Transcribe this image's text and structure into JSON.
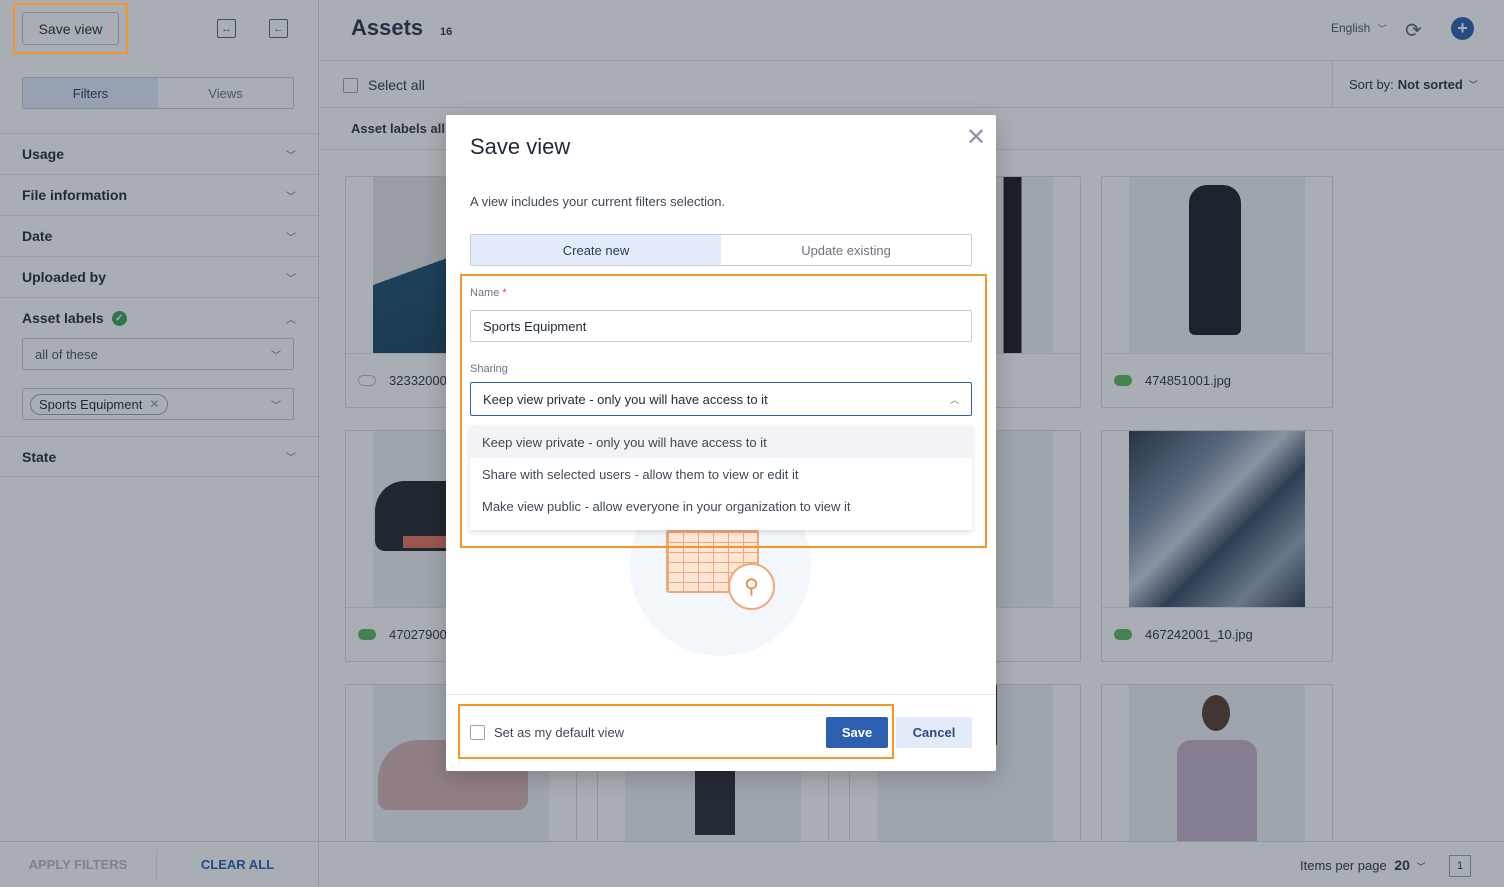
{
  "sidebar": {
    "save_view": "Save view",
    "tabs": [
      "Filters",
      "Views"
    ],
    "facets": {
      "usage": "Usage",
      "file_information": "File information",
      "date": "Date",
      "uploaded_by": "Uploaded by",
      "asset_labels": "Asset labels",
      "state": "State"
    },
    "match_select": "all of these",
    "chip": "Sports Equipment",
    "apply_filters": "APPLY FILTERS",
    "clear_all": "CLEAR ALL"
  },
  "header": {
    "title": "Assets",
    "count": "16",
    "language": "English",
    "select_all": "Select all",
    "sort_label": "Sort by:",
    "sort_value": "Not sorted",
    "labels_summary": "Asset labels all"
  },
  "cards": [
    {
      "name": "32332000",
      "cloud": "#b8c0cc"
    },
    {
      "name": "",
      "cloud": "#b8c0cc"
    },
    {
      "name": "",
      "cloud": "#b8c0cc"
    },
    {
      "name": "474851001.jpg",
      "cloud": "#5cb85c"
    },
    {
      "name": "47027900",
      "cloud": "#5cb85c"
    },
    {
      "name": "",
      "cloud": "#b8c0cc"
    },
    {
      "name": "",
      "cloud": "#b8c0cc"
    },
    {
      "name": "467242001_10.jpg",
      "cloud": "#5cb85c"
    }
  ],
  "footer": {
    "items_per_page_label": "Items per page",
    "items_per_page_value": "20",
    "page": "1"
  },
  "modal": {
    "title": "Save view",
    "description": "A view includes your current filters selection.",
    "tabs": [
      "Create new",
      "Update existing"
    ],
    "name_label": "Name",
    "name_value": "Sports Equipment",
    "sharing_label": "Sharing",
    "sharing_value": "Keep view private - only you will have access to it",
    "sharing_options": [
      "Keep view private - only you will have access to it",
      "Share with selected users - allow them to view or edit it",
      "Make view public - allow everyone in your organization to view it"
    ],
    "default_checkbox": "Set as my default view",
    "save": "Save",
    "cancel": "Cancel"
  },
  "colors": {
    "accent": "#2c5fb0",
    "highlight": "#f5962b",
    "success": "#3aa35b"
  }
}
